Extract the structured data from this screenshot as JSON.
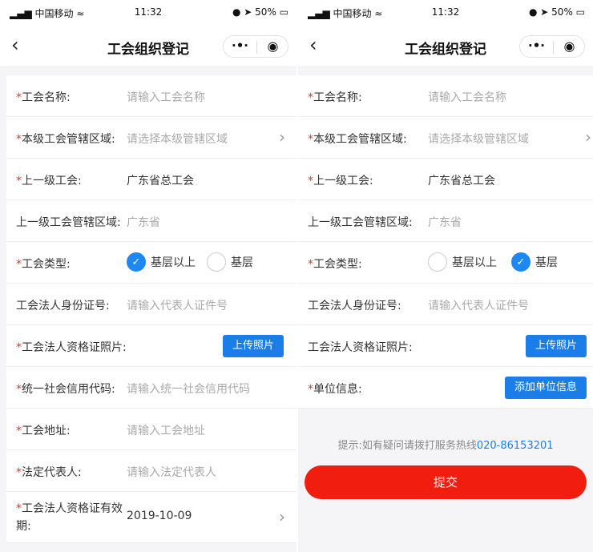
{
  "status": {
    "carrier": "▂▄▆ 中国移动 ≈",
    "time": "11:32",
    "battery": "● ➤ 50% ▭"
  },
  "nav": {
    "title": "工会组织登记",
    "back": "‹",
    "more": "·•·",
    "close": "◉"
  },
  "common": {
    "required": "*",
    "union_name_label": "工会名称:",
    "union_name_ph": "请输入工会名称",
    "area_label": "本级工会管辖区域:",
    "area_ph": "请选择本级管辖区域",
    "parent_label": "上一级工会:",
    "parent_value": "广东省总工会",
    "parent_area_label": "上一级工会管辖区域:",
    "parent_area_value": "广东省",
    "type_label": "工会类型:",
    "type_opt1": "基层以上",
    "type_opt2": "基层",
    "id_label": "工会法人身份证号:",
    "id_ph": "请输入代表人证件号",
    "photo_label": "工会法人资格证照片:",
    "upload": "上传照片",
    "arrow": "›",
    "check": "✓"
  },
  "left": {
    "credit_label": "统一社会信用代码:",
    "credit_ph": "请输入统一社会信用代码",
    "addr_label": "工会地址:",
    "addr_ph": "请输入工会地址",
    "rep_label": "法定代表人:",
    "rep_ph": "请输入法定代表人",
    "validity_label": "工会法人资格证有效期:",
    "validity_value": "2019-10-09"
  },
  "right": {
    "unit_label": "单位信息:",
    "add_unit": "添加单位信息",
    "hint": "提示:如有疑问请拨打服务热线",
    "hotline": "020-86153201",
    "submit": "提交"
  }
}
